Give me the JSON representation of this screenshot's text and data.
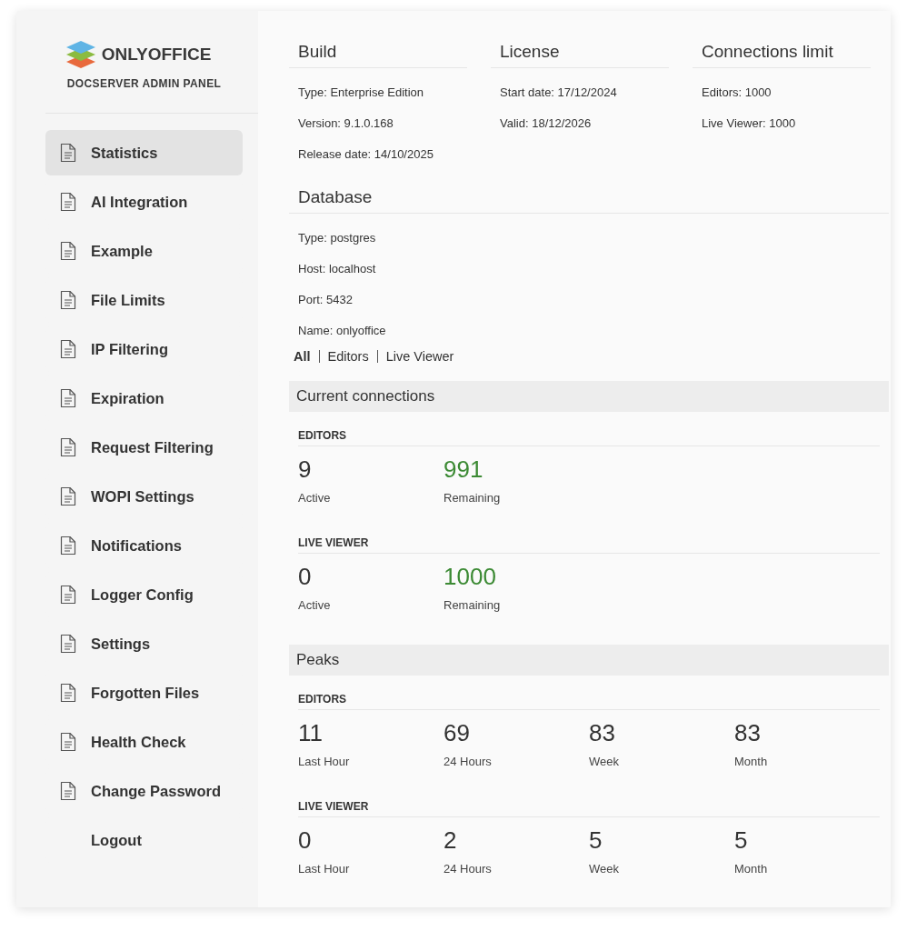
{
  "brand": {
    "name": "ONLYOFFICE",
    "subtitle": "DOCSERVER ADMIN PANEL"
  },
  "sidebar": {
    "items": [
      {
        "label": "Statistics",
        "kind": "page",
        "selected": true
      },
      {
        "label": "AI Integration",
        "kind": "page",
        "selected": false
      },
      {
        "label": "Example",
        "kind": "page",
        "selected": false
      },
      {
        "label": "File Limits",
        "kind": "page",
        "selected": false
      },
      {
        "label": "IP Filtering",
        "kind": "page",
        "selected": false
      },
      {
        "label": "Expiration",
        "kind": "page",
        "selected": false
      },
      {
        "label": "Request Filtering",
        "kind": "page",
        "selected": false
      },
      {
        "label": "WOPI Settings",
        "kind": "page",
        "selected": false
      },
      {
        "label": "Notifications",
        "kind": "page",
        "selected": false
      },
      {
        "label": "Logger Config",
        "kind": "page",
        "selected": false
      },
      {
        "label": "Settings",
        "kind": "page",
        "selected": false
      },
      {
        "label": "Forgotten Files",
        "kind": "page",
        "selected": false
      },
      {
        "label": "Health Check",
        "kind": "page",
        "selected": false
      },
      {
        "label": "Change Password",
        "kind": "page",
        "selected": false
      },
      {
        "label": "Logout",
        "kind": "action",
        "selected": false
      }
    ]
  },
  "info_sections": [
    {
      "title": "Build",
      "lines": [
        "Type: Enterprise Edition",
        "Version: 9.1.0.168",
        "Release date: 14/10/2025"
      ]
    },
    {
      "title": "License",
      "lines": [
        "Start date: 17/12/2024",
        "Valid: 18/12/2026"
      ]
    },
    {
      "title": "Connections limit",
      "lines": [
        "Editors: 1000",
        "Live Viewer: 1000"
      ]
    }
  ],
  "database": {
    "title": "Database",
    "lines": [
      "Type: postgres",
      "Host: localhost",
      "Port: 5432",
      "Name: onlyoffice"
    ]
  },
  "filter_tabs": [
    {
      "label": "All",
      "selected": true
    },
    {
      "label": "Editors",
      "selected": false
    },
    {
      "label": "Live Viewer",
      "selected": false
    }
  ],
  "panels": [
    {
      "title": "Current connections",
      "groups": [
        {
          "title": "EDITORS",
          "stats": [
            {
              "value": "9",
              "label": "Active",
              "kind": "count"
            },
            {
              "value": "991",
              "label": "Remaining",
              "kind": "remaining"
            }
          ]
        },
        {
          "title": "LIVE VIEWER",
          "stats": [
            {
              "value": "0",
              "label": "Active",
              "kind": "count"
            },
            {
              "value": "1000",
              "label": "Remaining",
              "kind": "remaining"
            }
          ]
        }
      ]
    },
    {
      "title": "Peaks",
      "groups": [
        {
          "title": "EDITORS",
          "stats": [
            {
              "value": "11",
              "label": "Last Hour",
              "kind": "count"
            },
            {
              "value": "69",
              "label": "24 Hours",
              "kind": "count"
            },
            {
              "value": "83",
              "label": "Week",
              "kind": "count"
            },
            {
              "value": "83",
              "label": "Month",
              "kind": "count"
            }
          ]
        },
        {
          "title": "LIVE VIEWER",
          "stats": [
            {
              "value": "0",
              "label": "Last Hour",
              "kind": "count"
            },
            {
              "value": "2",
              "label": "24 Hours",
              "kind": "count"
            },
            {
              "value": "5",
              "label": "Week",
              "kind": "count"
            },
            {
              "value": "5",
              "label": "Month",
              "kind": "count"
            }
          ]
        }
      ]
    }
  ]
}
